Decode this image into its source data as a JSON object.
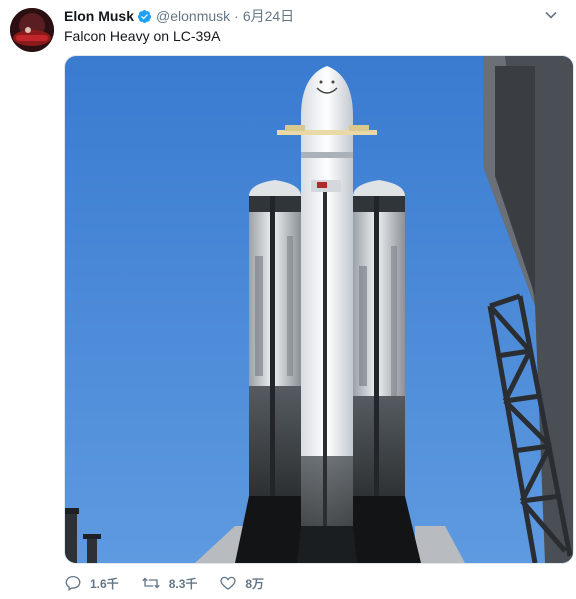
{
  "author": {
    "name": "Elon Musk",
    "handle": "@elonmusk",
    "separator": "·",
    "date": "6月24日"
  },
  "tweet": {
    "text": "Falcon Heavy on LC-39A"
  },
  "media": {
    "subject": "rocket-photo",
    "sky_color": "#3b7fd4"
  },
  "actions": {
    "reply": {
      "icon": "reply-icon",
      "count": "1.6千"
    },
    "retweet": {
      "icon": "retweet-icon",
      "count": "8.3千"
    },
    "like": {
      "icon": "heart-icon",
      "count": "8万"
    }
  },
  "colors": {
    "verified": "#1da1f2",
    "muted": "#657786",
    "text": "#14171a"
  }
}
